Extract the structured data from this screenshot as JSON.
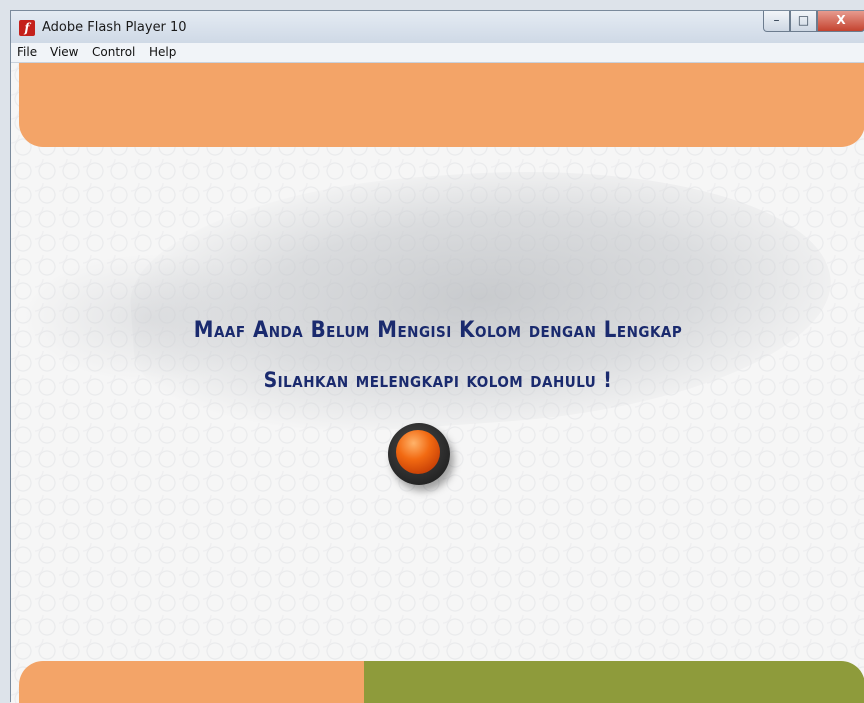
{
  "window": {
    "title": "Adobe Flash Player 10",
    "controls": {
      "minimize": "–",
      "maximize": "□",
      "close": "X"
    }
  },
  "menu": [
    {
      "label": "File"
    },
    {
      "label": "View"
    },
    {
      "label": "Control"
    },
    {
      "label": "Help"
    }
  ],
  "dialog": {
    "line1": "Maaf Anda Belum Mengisi Kolom dengan Lengkap",
    "line2": "Silahkan melengkapi kolom dahulu !"
  },
  "colors": {
    "header_band": "#f3a468",
    "footer_left": "#f3a468",
    "footer_right": "#8e9b3b",
    "message_text": "#1a2a6e",
    "button": "#f26a12"
  },
  "icons": {
    "app": "flash-icon",
    "ok": "orange-round-button"
  }
}
